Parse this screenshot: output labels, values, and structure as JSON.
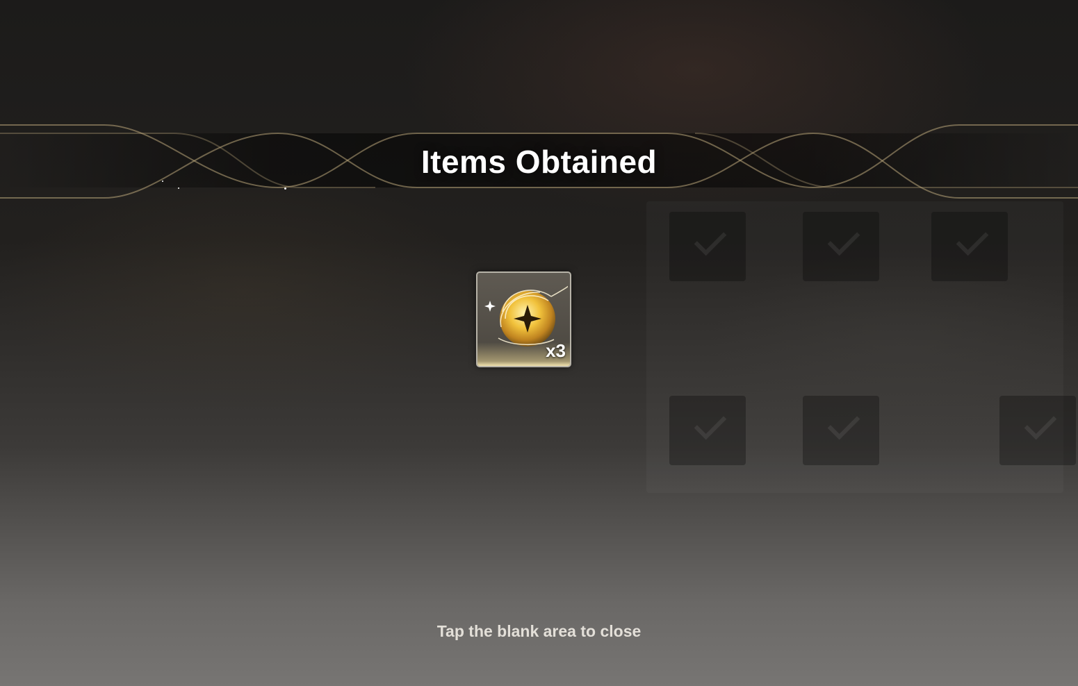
{
  "dialog": {
    "title": "Items Obtained",
    "close_hint": "Tap the blank area to close"
  },
  "items": [
    {
      "icon": "golden-orb-icon",
      "quantity_label": "x3",
      "rarity_color": "#e6c670"
    }
  ],
  "colors": {
    "accent_gold": "#c9b27a",
    "title_text": "#ffffff",
    "hint_text": "#e3dfd8"
  }
}
